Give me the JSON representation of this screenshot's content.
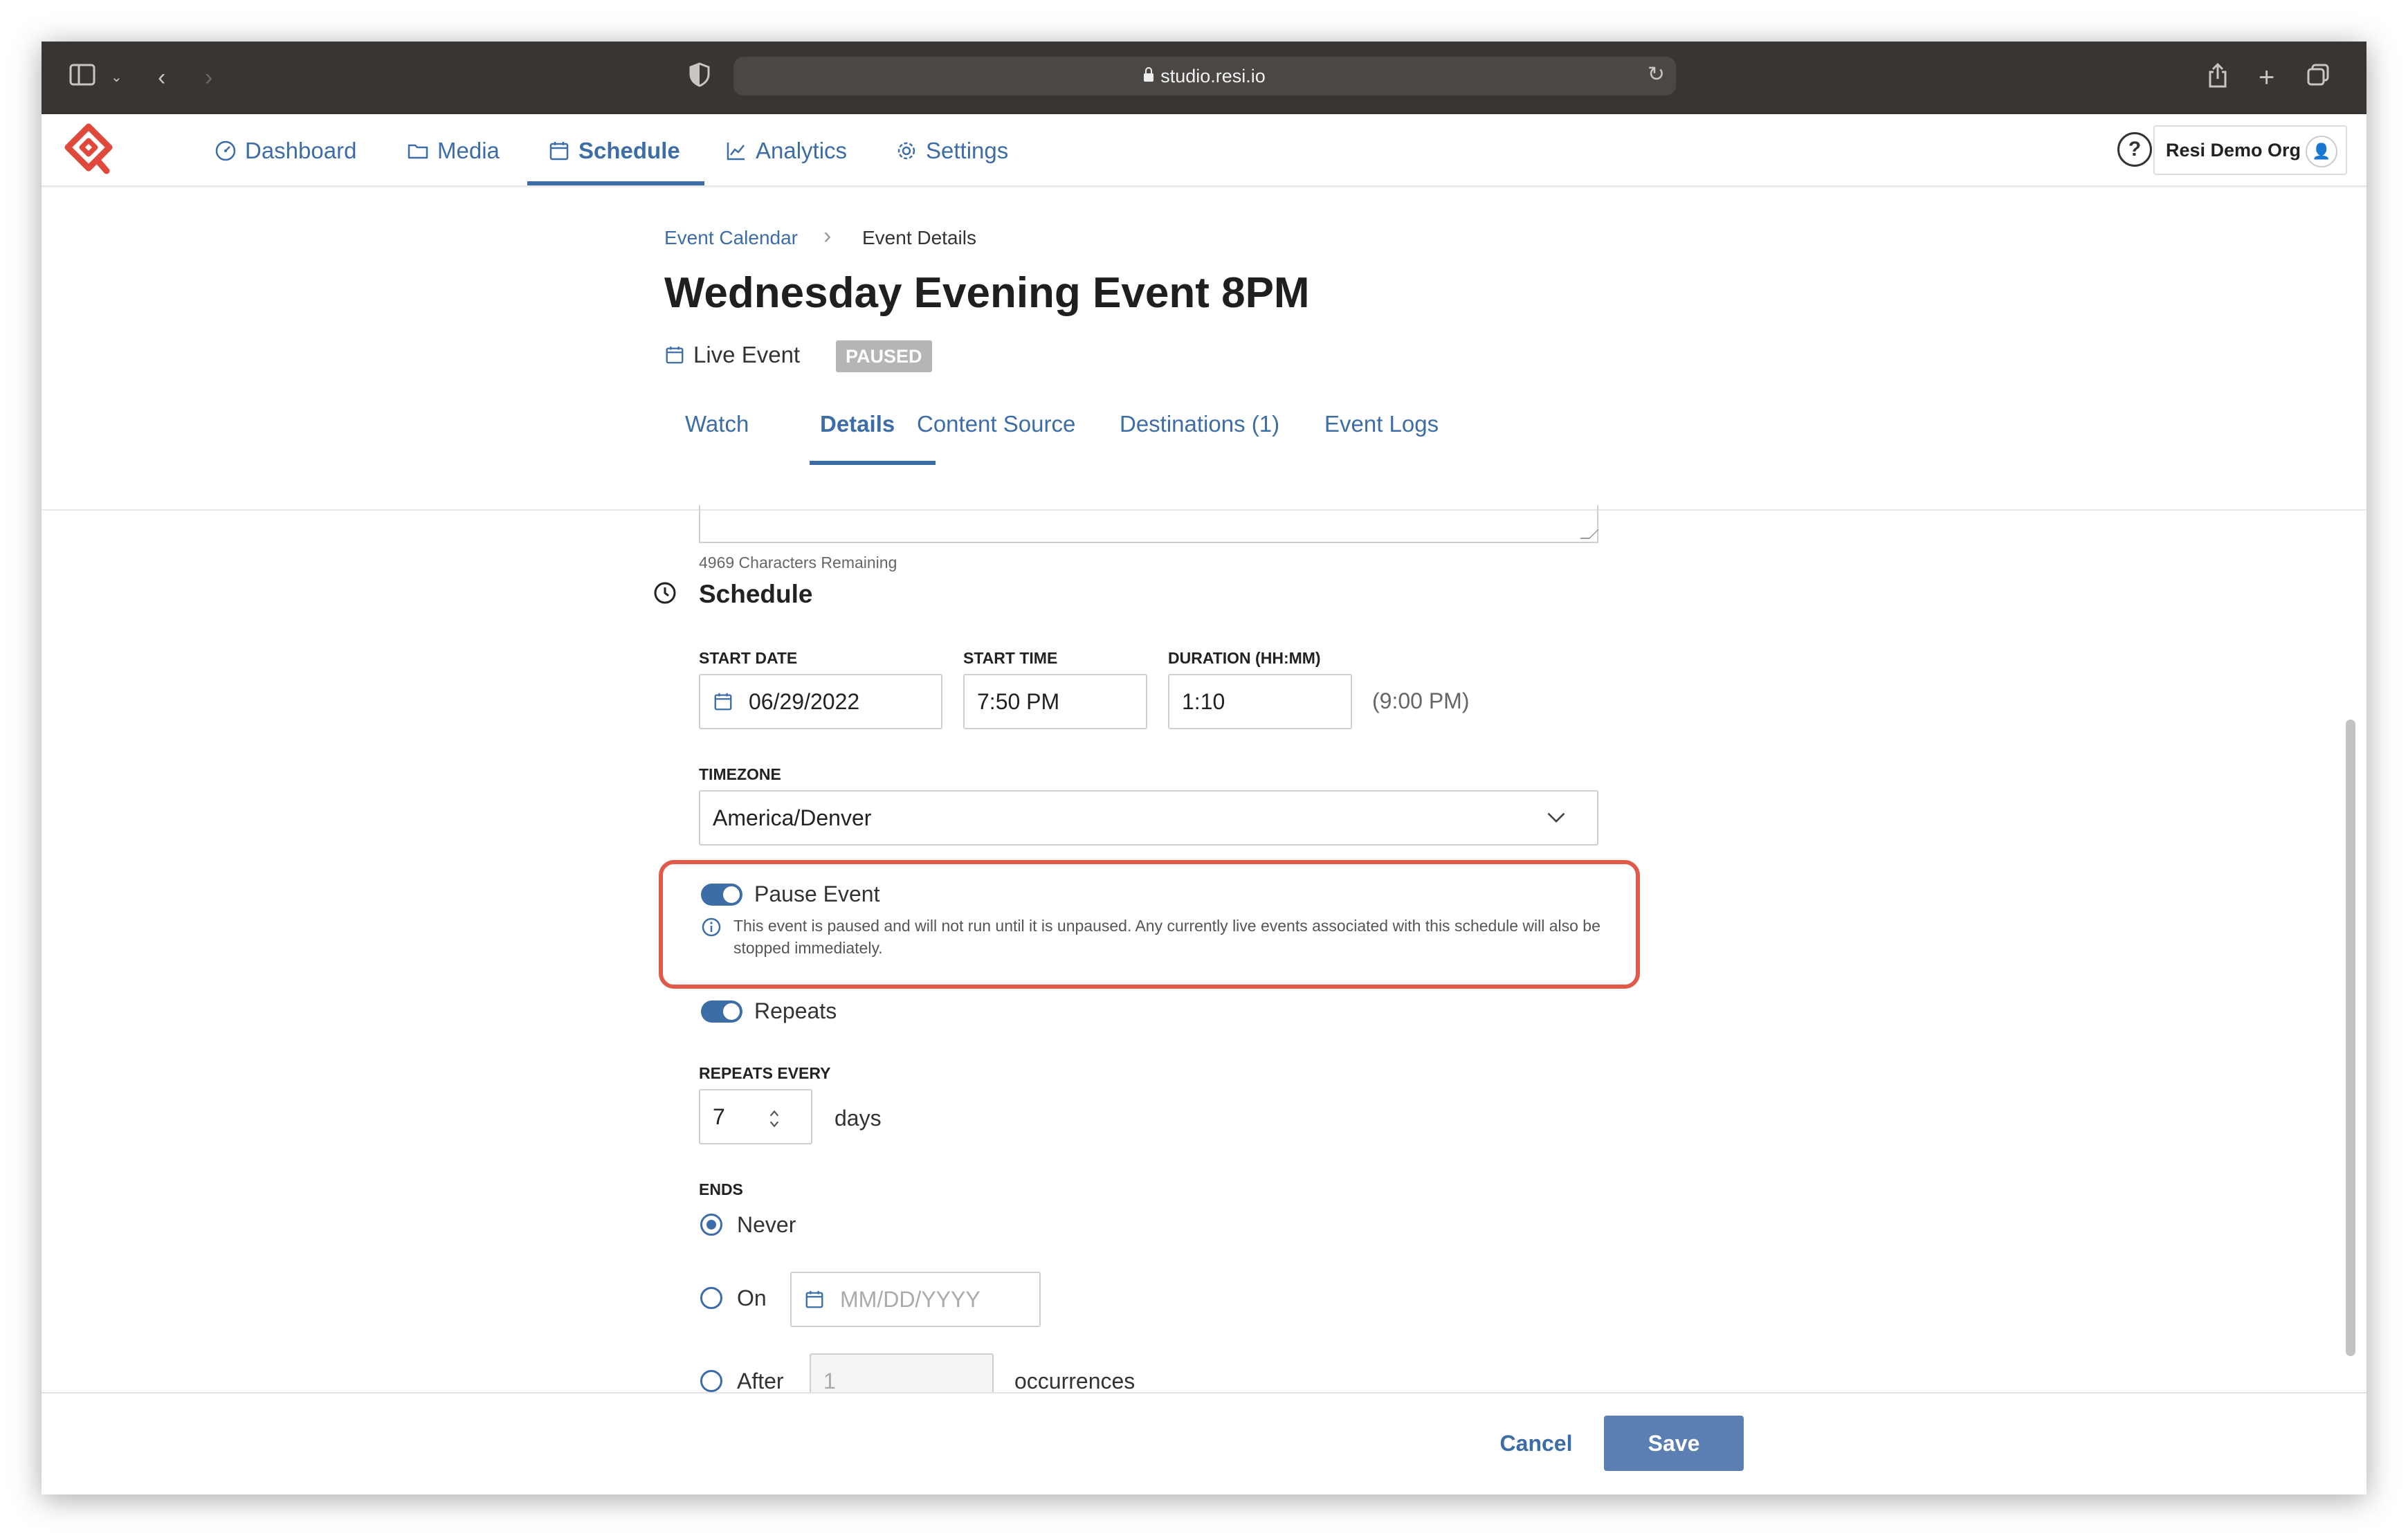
{
  "browser": {
    "url": "studio.resi.io"
  },
  "nav": {
    "items": [
      {
        "label": "Dashboard",
        "icon": "gauge-icon"
      },
      {
        "label": "Media",
        "icon": "folder-icon"
      },
      {
        "label": "Schedule",
        "icon": "calendar-icon"
      },
      {
        "label": "Analytics",
        "icon": "chart-line-icon"
      },
      {
        "label": "Settings",
        "icon": "gear-icon"
      }
    ],
    "help": "?",
    "org": "Resi Demo Org"
  },
  "breadcrumb": {
    "parent": "Event Calendar",
    "current": "Event Details"
  },
  "event": {
    "title": "Wednesday Evening Event 8PM",
    "type": "Live Event",
    "status": "PAUSED"
  },
  "tabs": [
    "Watch",
    "Details",
    "Content Source",
    "Destinations (1)",
    "Event Logs"
  ],
  "description": {
    "remaining": "4969 Characters Remaining"
  },
  "schedule": {
    "title": "Schedule",
    "start_date_label": "START DATE",
    "start_date": "06/29/2022",
    "start_time_label": "START TIME",
    "start_time": "7:50 PM",
    "duration_label": "DURATION (HH:MM)",
    "duration": "1:10",
    "end_time": "(9:00 PM)",
    "timezone_label": "TIMEZONE",
    "timezone": "America/Denver",
    "pause_label": "Pause Event",
    "pause_on": true,
    "pause_info": "This event is paused and will not run until it is unpaused. Any currently live events associated with this schedule will also be stopped immediately.",
    "repeats_label": "Repeats",
    "repeats_on": true,
    "repeats_every_label": "REPEATS EVERY",
    "repeats_every": "7",
    "repeats_unit": "days",
    "ends_label": "ENDS",
    "ends_never": "Never",
    "ends_on": "On",
    "ends_on_placeholder": "MM/DD/YYYY",
    "ends_after": "After",
    "ends_after_value": "1",
    "ends_after_unit": "occurrences"
  },
  "footer": {
    "cancel": "Cancel",
    "save": "Save"
  },
  "colors": {
    "accent": "#3d6da6",
    "highlight": "#e05a4a",
    "save": "#5b7fb3",
    "badge": "#b5b5b5"
  }
}
